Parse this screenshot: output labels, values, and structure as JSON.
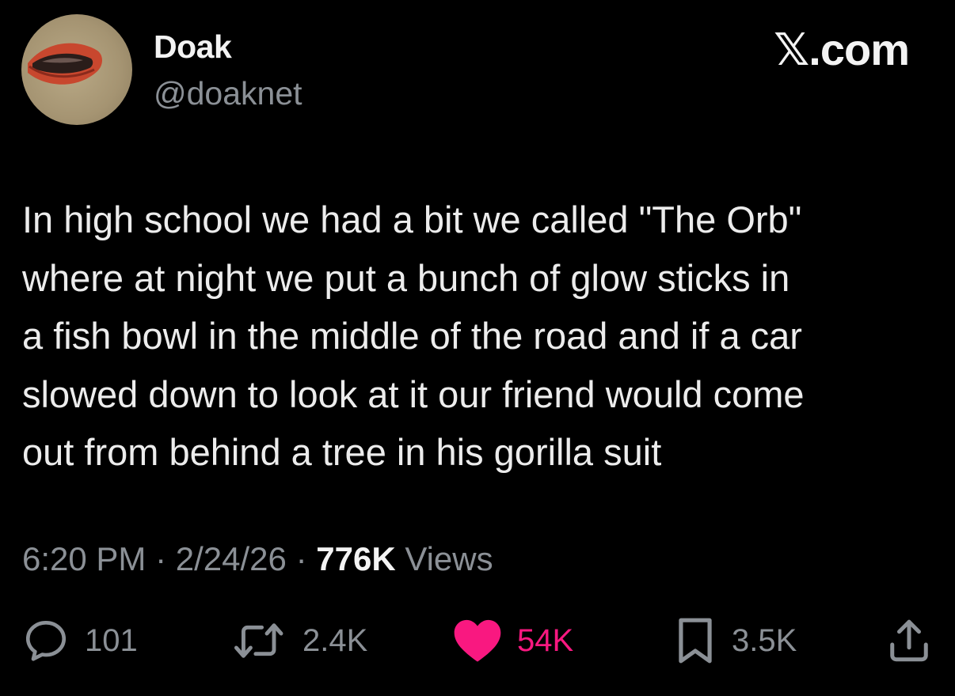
{
  "author": {
    "display_name": "Doak",
    "handle": "@doaknet",
    "avatar_icon": "lips-avatar"
  },
  "brand": "𝕏.com",
  "tweet": {
    "lines": [
      "In high school we had a bit we called \"The Orb\"",
      "where at night we put a bunch of glow sticks in",
      "a fish bowl in the middle of the road and if a car",
      "slowed down to look at it our friend would come",
      "out from behind a tree in his gorilla suit"
    ]
  },
  "meta": {
    "time": "6:20 PM",
    "separator": "·",
    "date": "2/24/26",
    "views_count": "776K",
    "views_label": "Views"
  },
  "actions": {
    "replies": {
      "icon": "reply-icon",
      "count": "101"
    },
    "reposts": {
      "icon": "repost-icon",
      "count": "2.4K"
    },
    "likes": {
      "icon": "heart-icon",
      "count": "54K",
      "color": "#f91880"
    },
    "bookmarks": {
      "icon": "bookmark-icon",
      "count": "3.5K"
    },
    "share": {
      "icon": "share-icon"
    }
  },
  "colors": {
    "background": "#000000",
    "text": "#e7e9ea",
    "muted": "#8b9096",
    "like": "#f91880"
  }
}
